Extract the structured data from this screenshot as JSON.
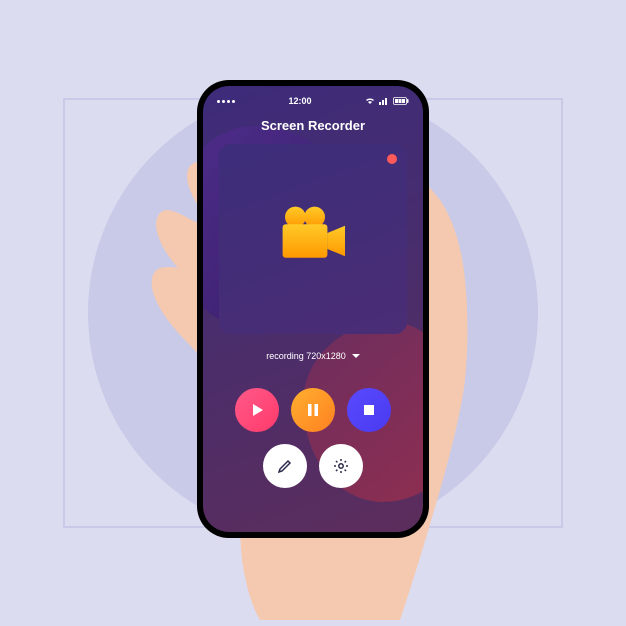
{
  "status_bar": {
    "time": "12:00"
  },
  "app": {
    "title": "Screen Recorder"
  },
  "resolution": {
    "label": "recording 720x1280"
  }
}
